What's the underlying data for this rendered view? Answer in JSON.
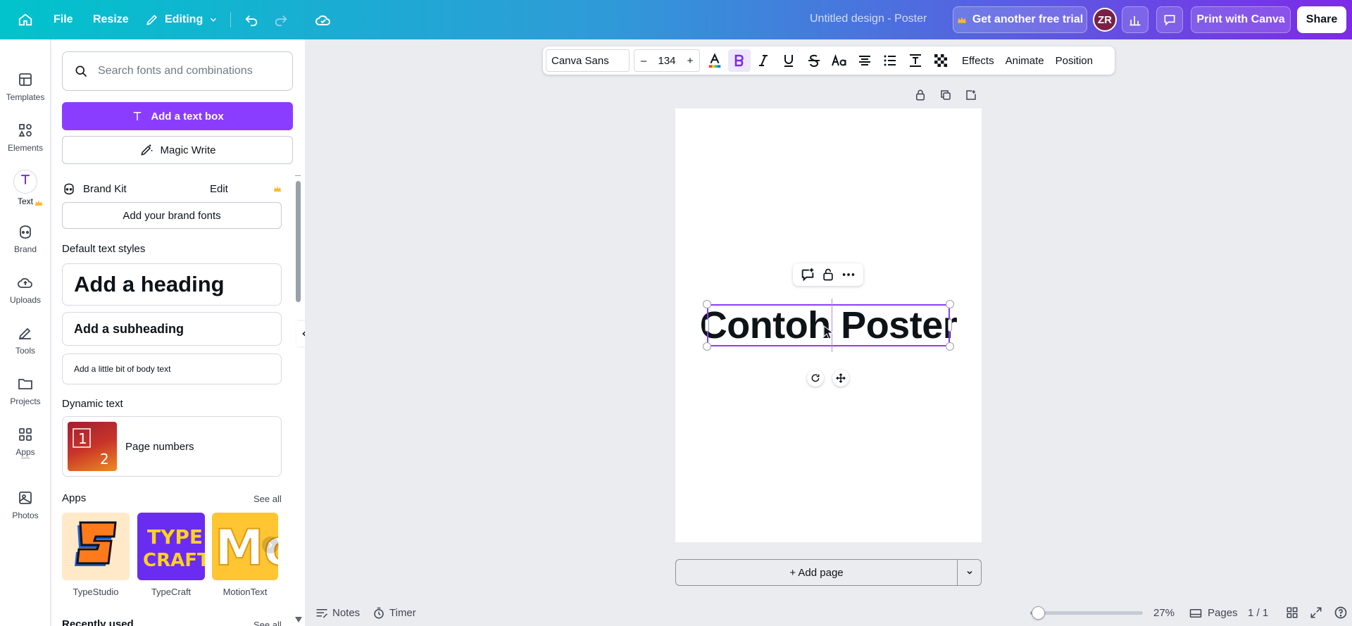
{
  "topbar": {
    "file": "File",
    "resize": "Resize",
    "mode": "Editing",
    "design_title": "Untitled design - Poster",
    "trial": "Get another free trial",
    "avatar": "ZR",
    "print": "Print with Canva",
    "share": "Share"
  },
  "sidebar": {
    "items": [
      {
        "label": "Templates",
        "icon": "templates-icon"
      },
      {
        "label": "Elements",
        "icon": "elements-icon"
      },
      {
        "label": "Text",
        "icon": "text-icon"
      },
      {
        "label": "Brand",
        "icon": "brand-icon"
      },
      {
        "label": "Uploads",
        "icon": "cloud-upload-icon"
      },
      {
        "label": "Tools",
        "icon": "pen-icon"
      },
      {
        "label": "Projects",
        "icon": "folder-icon"
      },
      {
        "label": "Apps",
        "icon": "apps-icon"
      },
      {
        "label": "Photos",
        "icon": "image-icon"
      }
    ]
  },
  "panel": {
    "search_placeholder": "Search fonts and combinations",
    "add_text_box": "Add a text box",
    "magic_write": "Magic Write",
    "brand_kit": "Brand Kit",
    "brand_edit": "Edit",
    "add_brand_fonts": "Add your brand fonts",
    "default_styles": "Default text styles",
    "heading": "Add a heading",
    "subheading": "Add a subheading",
    "body": "Add a little bit of body text",
    "dynamic_text": "Dynamic text",
    "page_numbers": "Page numbers",
    "apps_title": "Apps",
    "see_all": "See all",
    "apps": [
      {
        "name": "TypeStudio"
      },
      {
        "name": "TypeCraft"
      },
      {
        "name": "MotionText"
      }
    ],
    "recently_used": "Recently used",
    "see_all_2": "See all"
  },
  "toolbar": {
    "font": "Canva Sans",
    "font_size": "134",
    "effects": "Effects",
    "animate": "Animate",
    "position": "Position"
  },
  "canvas": {
    "text": "Contoh Poster",
    "add_page": "+ Add page"
  },
  "bottombar": {
    "notes": "Notes",
    "timer": "Timer",
    "zoom_value": 0.27,
    "zoom": "27%",
    "pages": "Pages",
    "page_count": "1 / 1"
  },
  "colors": {
    "accent": "#8b3dff",
    "topbar_start": "#01c3cc",
    "topbar_end": "#7d2ae8",
    "crown": "#ffb82e"
  }
}
